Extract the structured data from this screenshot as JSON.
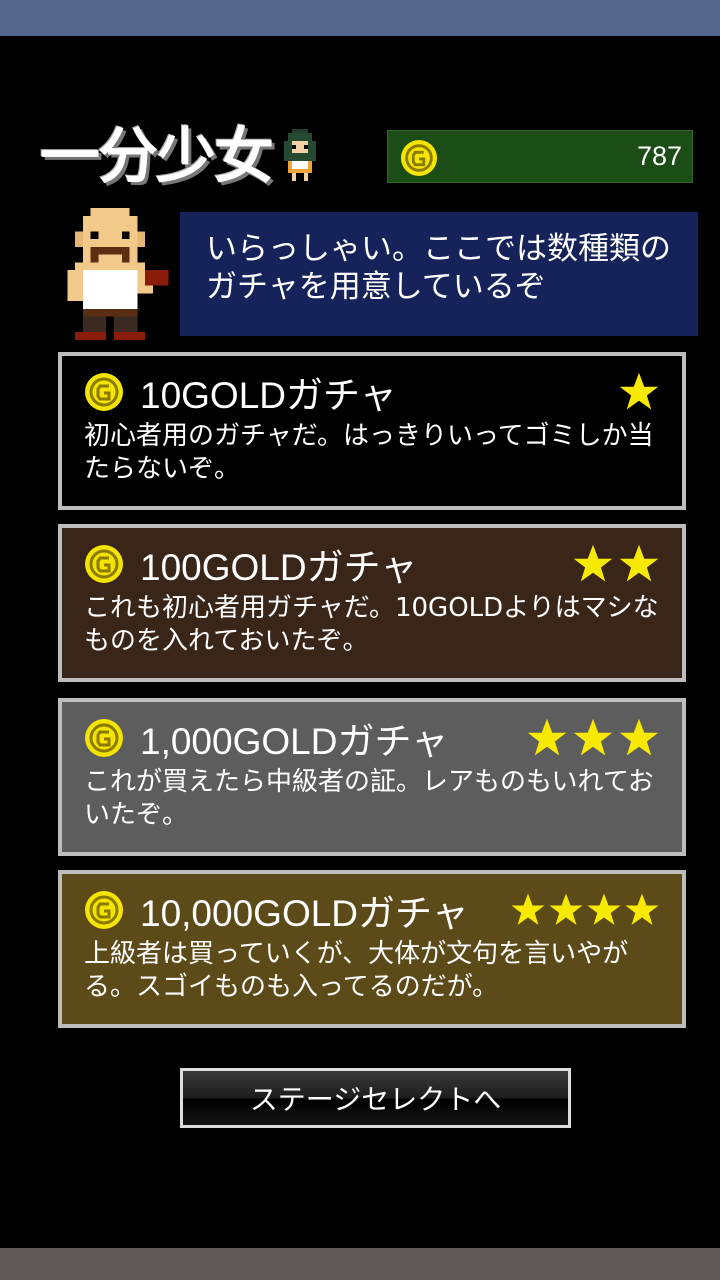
{
  "header": {
    "logo_text": "一分少女",
    "gold_amount": "787"
  },
  "shopkeeper": {
    "speech": "いらっしゃい。ここでは数種類のガチャを用意しているぞ"
  },
  "gachas": [
    {
      "title": "10GOLDガチャ",
      "stars": 1,
      "description": "初心者用のガチャだ。はっきりいってゴミしか当たらないぞ。",
      "bg_color": "#000000"
    },
    {
      "title": "100GOLDガチャ",
      "stars": 2,
      "description": "これも初心者用ガチャだ。10GOLDよりはマシなものを入れておいたぞ。",
      "bg_color": "#3a2619"
    },
    {
      "title": "1,000GOLDガチャ",
      "stars": 3,
      "description": "これが買えたら中級者の証。レアものもいれておいたぞ。",
      "bg_color": "#5d5d5d"
    },
    {
      "title": "10,000GOLDガチャ",
      "stars": 4,
      "description": "上級者は買っていくが、大体が文句を言いやがる。スゴイものも入ってるのだが。",
      "bg_color": "#5c4a19"
    }
  ],
  "footer": {
    "stage_select_label": "ステージセレクトへ"
  },
  "colors": {
    "gold_coin": "#f5e400",
    "star": "#f7ea00",
    "gold_panel": "#1d4d16",
    "speech_bg": "#16235a"
  }
}
